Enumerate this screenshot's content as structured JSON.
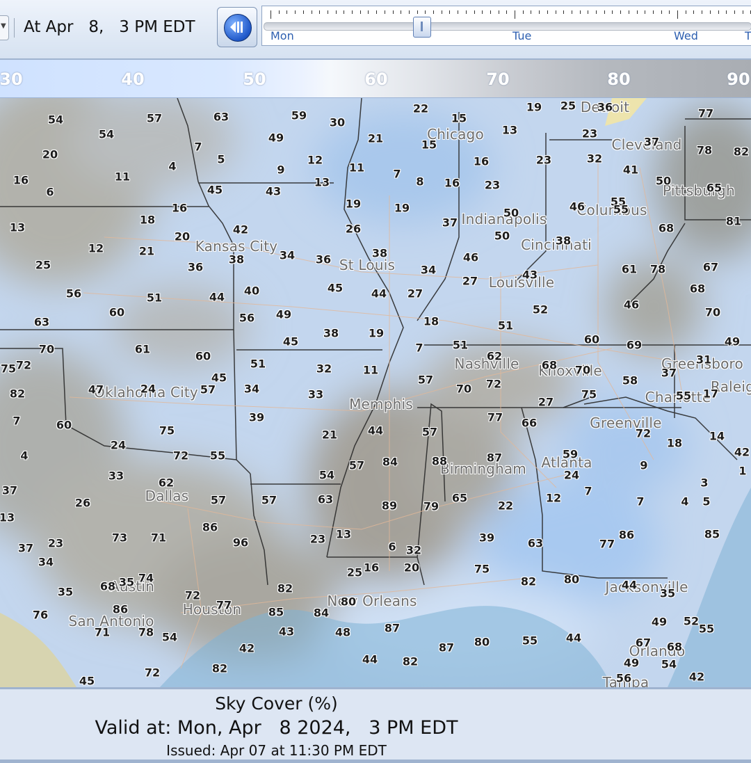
{
  "toolbar": {
    "dropdown_icon": "chevron-down-icon",
    "time_label": "At Apr   8,   3 PM EDT",
    "play_icon": "step-back-icon",
    "timeline": {
      "days": [
        "Mon",
        "Tue",
        "Wed",
        "T"
      ],
      "selected_label": "Mon, Apr 8 2024, 3 PM EDT"
    }
  },
  "scale": {
    "labels": [
      "30",
      "40",
      "50",
      "60",
      "70",
      "80",
      "90"
    ],
    "colors": {
      "low": "#cfe2ff",
      "mid": "#f5f8fc",
      "high": "#a9adb3"
    }
  },
  "map": {
    "cities": [
      "Chicago",
      "Detroit",
      "Cleveland",
      "Pittsburgh",
      "Indianapolis",
      "Columbus",
      "Cincinnati",
      "Kansas City",
      "St Louis",
      "Louisville",
      "Nashville",
      "Knoxville",
      "Greensboro",
      "Raleigh",
      "Charlotte",
      "Greenville",
      "Oklahoma City",
      "Memphis",
      "Atlanta",
      "Birmingham",
      "Dallas",
      "Austin",
      "San Antonio",
      "Houston",
      "New Orleans",
      "Jacksonville",
      "Orlando",
      "Tampa"
    ],
    "values": [
      "54",
      "57",
      "63",
      "59",
      "30",
      "22",
      "15",
      "19",
      "25",
      "36",
      "77",
      "7",
      "54",
      "49",
      "21",
      "13",
      "23",
      "37",
      "78",
      "82",
      "20",
      "5",
      "12",
      "15",
      "16",
      "23",
      "32",
      "41",
      "4",
      "9",
      "11",
      "7",
      "8",
      "16",
      "23",
      "50",
      "65",
      "16",
      "11",
      "6",
      "45",
      "43",
      "13",
      "55",
      "19",
      "19",
      "26",
      "37",
      "50",
      "46",
      "55",
      "16",
      "13",
      "18",
      "42",
      "68",
      "81",
      "12",
      "21",
      "20",
      "38",
      "50",
      "38",
      "25",
      "36",
      "38",
      "34",
      "36",
      "34",
      "46",
      "43",
      "61",
      "78",
      "67",
      "56",
      "51",
      "44",
      "40",
      "45",
      "44",
      "27",
      "27",
      "52",
      "68",
      "60",
      "56",
      "49",
      "18",
      "46",
      "63",
      "19",
      "51",
      "70",
      "45",
      "38",
      "7",
      "51",
      "60",
      "69",
      "49",
      "70",
      "61",
      "60",
      "51",
      "11",
      "32",
      "62",
      "68",
      "70",
      "31",
      "75",
      "45",
      "57",
      "70",
      "72",
      "58",
      "37",
      "72",
      "34",
      "33",
      "27",
      "75",
      "55",
      "17",
      "82",
      "47",
      "24",
      "57",
      "39",
      "7",
      "60",
      "75",
      "21",
      "44",
      "57",
      "77",
      "66",
      "72",
      "18",
      "14",
      "4",
      "24",
      "72",
      "55",
      "42",
      "54",
      "57",
      "84",
      "88",
      "87",
      "59",
      "9",
      "1",
      "33",
      "62",
      "24",
      "3",
      "37",
      "26",
      "57",
      "57",
      "63",
      "89",
      "79",
      "65",
      "22",
      "12",
      "7",
      "7",
      "4",
      "5",
      "13",
      "73",
      "71",
      "86",
      "96",
      "23",
      "13",
      "6",
      "32",
      "39",
      "63",
      "77",
      "86",
      "85",
      "37",
      "23",
      "25",
      "16",
      "20",
      "75",
      "82",
      "80",
      "44",
      "35",
      "34",
      "35",
      "35",
      "68",
      "74",
      "72",
      "77",
      "82",
      "80",
      "84",
      "85",
      "48",
      "87",
      "80",
      "55",
      "44",
      "49",
      "52",
      "55",
      "76",
      "86",
      "71",
      "78",
      "54",
      "43",
      "44",
      "82",
      "87",
      "67",
      "68",
      "54",
      "56",
      "49",
      "42",
      "82",
      "72",
      "45",
      "42"
    ]
  },
  "footer": {
    "title": "Sky Cover (%)",
    "valid": "Valid at: Mon, Apr   8 2024,   3 PM EDT",
    "issued": "Issued: Apr 07 at 11:30 PM EDT"
  }
}
